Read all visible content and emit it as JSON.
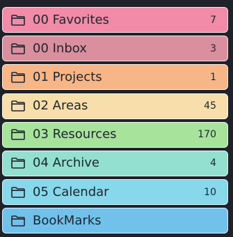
{
  "folders": [
    {
      "label": "00 Favorites",
      "count": "7",
      "color": "#f28ba8",
      "icon": "folder-icon"
    },
    {
      "label": "00 Inbox",
      "count": "3",
      "color": "#d98f9d",
      "icon": "folder-icon"
    },
    {
      "label": "01 Projects",
      "count": "1",
      "color": "#f7b688",
      "icon": "folder-icon"
    },
    {
      "label": "02 Areas",
      "count": "45",
      "color": "#f7deaa",
      "icon": "folder-icon"
    },
    {
      "label": "03 Resources",
      "count": "170",
      "color": "#a7e39b",
      "icon": "folder-icon"
    },
    {
      "label": "04 Archive",
      "count": "4",
      "color": "#93e0d0",
      "icon": "folder-icon"
    },
    {
      "label": "05 Calendar",
      "count": "10",
      "color": "#86d8ea",
      "icon": "folder-icon"
    },
    {
      "label": "BookMarks",
      "count": "",
      "color": "#72c1ea",
      "icon": "folder-icon"
    }
  ]
}
